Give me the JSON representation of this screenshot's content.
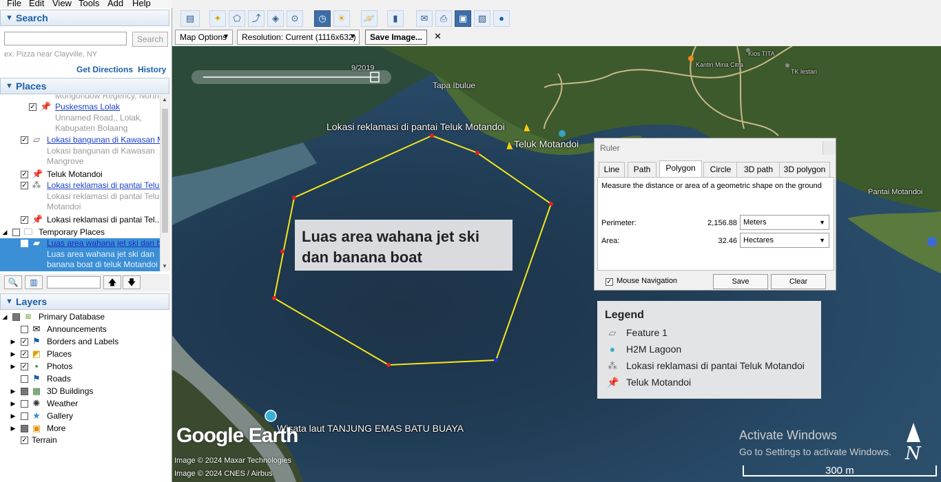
{
  "menu": [
    "File",
    "Edit",
    "View",
    "Tools",
    "Add",
    "Help"
  ],
  "search": {
    "title": "Search",
    "button": "Search",
    "hint": "ex: Pizza near Clayville, NY",
    "get_directions": "Get Directions",
    "history": "History"
  },
  "places": {
    "title": "Places",
    "rows": [
      {
        "text": "Mongondow Regency, North",
        "style": "gray"
      },
      {
        "text": "Puskesmas Lolak",
        "style": "link"
      },
      {
        "text": "Unnamed Road,, Lolak,",
        "style": "gray"
      },
      {
        "text": "Kabupaten Bolaang",
        "style": "gray"
      },
      {
        "text": "Lokasi bangunan di Kawasan M",
        "style": "link"
      },
      {
        "text": "Lokasi bangunan di Kawasan",
        "style": "gray"
      },
      {
        "text": "Mangrove",
        "style": "gray"
      },
      {
        "text": "Teluk Motandoi",
        "style": "plain"
      },
      {
        "text": "Lokasi reklamasi di pantai Teluk",
        "style": "link"
      },
      {
        "text": "Lokasi reklamasi di pantai Teluk",
        "style": "gray"
      },
      {
        "text": "Motandoi",
        "style": "gray"
      },
      {
        "text": "Lokasi reklamasi di pantai Tel...",
        "style": "plain"
      },
      {
        "text": "Temporary Places",
        "style": "plain"
      },
      {
        "text": "Luas area wahana jet ski dan ba",
        "style": "link"
      },
      {
        "text": "Luas area wahana jet ski dan",
        "style": "selgray"
      },
      {
        "text": "banana boat di teluk Motandoi",
        "style": "selgray"
      }
    ]
  },
  "layers": {
    "title": "Layers",
    "items": [
      "Primary Database",
      "Announcements",
      "Borders and Labels",
      "Places",
      "Photos",
      "Roads",
      "3D Buildings",
      "Weather",
      "Gallery",
      "More",
      "Terrain"
    ]
  },
  "options": {
    "map_options": "Map Options",
    "resolution": "Resolution: Current (1116x632)",
    "save_image": "Save Image...",
    "close": "✕"
  },
  "map": {
    "date": "9/2019",
    "callout": "Luas area wahana jet ski dan banana boat",
    "labels": [
      "Tapa Ibulue",
      "Lokasi reklamasi di pantai Teluk Motandoi",
      "Teluk Motandoi",
      "Pantai Motandoi",
      "Wisata laut TANJUNG EMAS BATU BUAYA",
      "Kios TITA",
      "Kantin Mina Citra",
      "TK lestari"
    ],
    "logo": "Google Earth",
    "copyright": [
      "Image © 2024 Maxar Technologies",
      "Image © 2024 CNES / Airbus"
    ],
    "activate_title": "Activate Windows",
    "activate_sub": "Go to Settings to activate Windows.",
    "scale": "300 m",
    "compass": "N"
  },
  "ruler": {
    "title": "Ruler",
    "tabs": [
      "Line",
      "Path",
      "Polygon",
      "Circle",
      "3D path",
      "3D polygon"
    ],
    "description": "Measure the distance or area of a geometric shape on the ground",
    "perimeter_label": "Perimeter:",
    "perimeter_value": "2,156.88",
    "perimeter_unit": "Meters",
    "area_label": "Area:",
    "area_value": "32.46",
    "area_unit": "Hectares",
    "mouse_nav": "Mouse Navigation",
    "save": "Save",
    "clear": "Clear"
  },
  "legend": {
    "title": "Legend",
    "items": [
      "Feature 1",
      "H2M Lagoon",
      "Lokasi reklamasi di pantai Teluk Motandoi",
      "Teluk Motandoi"
    ]
  },
  "colors": {
    "polygon": "#f5e61b",
    "vertex": "#e8201a",
    "accent": "#1a5fa8"
  }
}
